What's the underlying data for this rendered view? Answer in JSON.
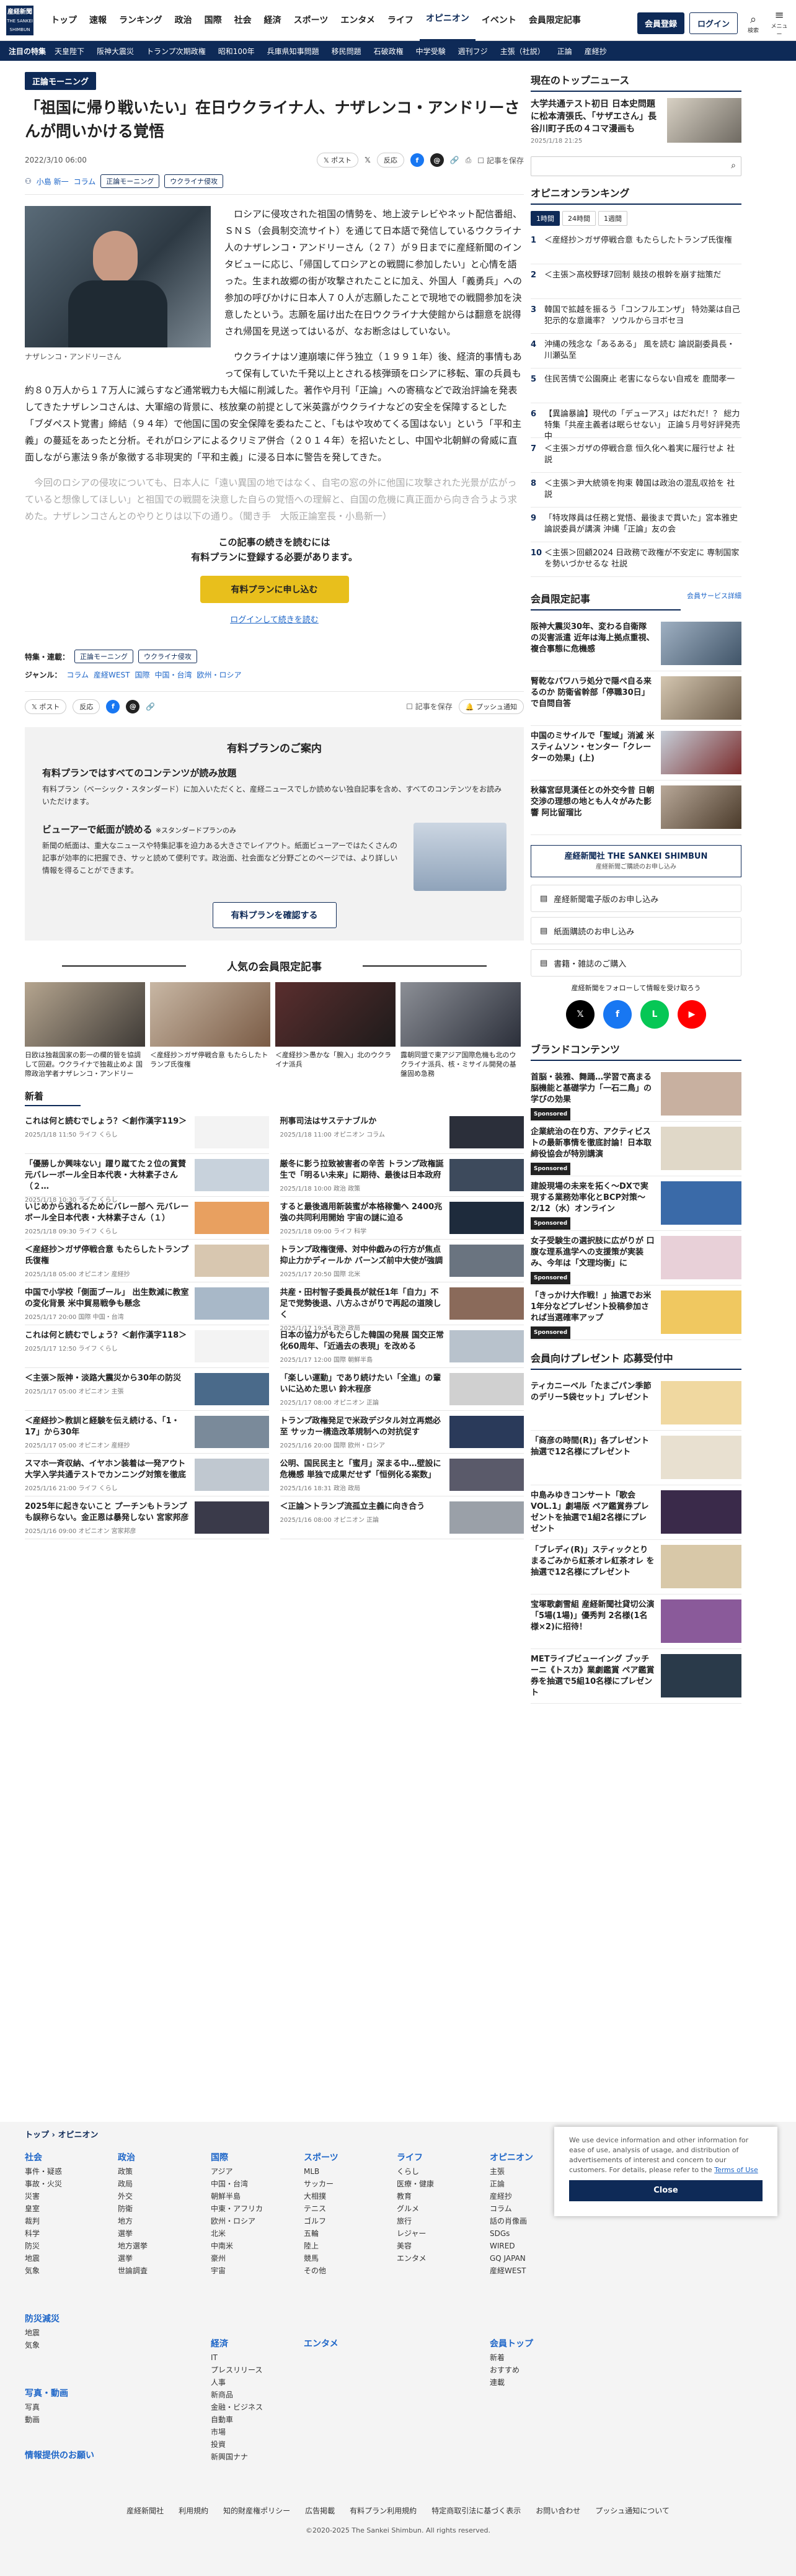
{
  "header": {
    "logo": "産経新聞",
    "logo_sub": "THE SANKEI SHIMBUN",
    "nav": [
      "トップ",
      "速報",
      "ランキング",
      "政治",
      "国際",
      "社会",
      "経済",
      "スポーツ",
      "エンタメ",
      "ライフ",
      "オピニオン",
      "イベント",
      "会員限定記事"
    ],
    "nav_active": "オピニオン",
    "register": "会員登録",
    "login": "ログイン",
    "search_label": "検索",
    "menu_label": "メニュー"
  },
  "subnav": [
    "注目の特集",
    "天皇陛下",
    "阪神大震災",
    "トランプ次期政権",
    "昭和100年",
    "兵庫県知事問題",
    "移民問題",
    "石破政権",
    "中学受験",
    "週刊フジ",
    "主張（社説）",
    "正論",
    "産経抄"
  ],
  "article": {
    "tag": "正論モーニング",
    "title": "「祖国に帰り戦いたい」在日ウクライナ人、ナザレンコ・アンドリーさんが問いかける覚悟",
    "date": "2022/3/10 06:00",
    "post_label": "ポスト",
    "fb_label": "反応",
    "save_label": "記事を保存",
    "author": "小島 新一",
    "author_section": "コラム",
    "tags": [
      "正論モーニング",
      "ウクライナ侵攻"
    ],
    "caption": "ナザレンコ・アンドリーさん",
    "para1": "ロシアに侵攻された祖国の情勢を、地上波テレビやネット配信番組、ＳＮＳ（会員制交流サイト）を通じて日本語で発信しているウクライナ人のナザレンコ・アンドリーさん（２７）が９日までに産経新聞のインタビューに応じ、「帰国してロシアとの戦闘に参加したい」と心情を語った。生まれ故郷の街が攻撃されたことに加え、外国人「義勇兵」への参加の呼びかけに日本人７０人が志願したことで現地での戦闘参加を決意したという。志願を届け出た在日ウクライナ大使館からは翻意を説得され帰国を見送ってはいるが、なお断念はしていない。",
    "para2": "ウクライナはソ連崩壊に伴う独立（１９９１年）後、経済的事情もあって保有していた千発以上とされる核弾頭をロシアに移転、軍の兵員も約８０万人から１７万人に減らすなど通常戦力も大幅に削減した。著作や月刊「正論」への寄稿などで政治評論を発表してきたナザレンコさんは、大軍縮の背景に、核放棄の前提として米英露がウクライナなどの安全を保障するとした「ブダペスト覚書」締結（９４年）で他国に国の安全保障を委ねたこと、「もはや攻めてくる国はない」という「平和主義」の蔓延をあったと分析。それがロシアによるクリミア併合（２０１４年）を招いたとし、中国や北朝鮮の脅威に直面しながら憲法９条が象徴する非現実的「平和主義」に浸る日本に警告を発してきた。",
    "para3": "今回のロシアの侵攻についても、日本人に「遠い異国の地ではなく、自宅の窓の外に他国に攻撃された光景が広がっていると想像してほしい」と祖国での戦闘を決意した自らの覚悟への理解と、自国の危機に真正面から向き合うよう求めた。ナザレンコさんとのやりとりは以下の通り。（聞き手　大阪正論室長・小島新一）",
    "wall_text1": "この記事の続きを読むには",
    "wall_text2": "有料プランに登録する必要があります。",
    "wall_cta": "有料プランに申し込む",
    "wall_login": "ログインして続きを読む",
    "feature_label": "特集・連載：",
    "features": [
      "正論モーニング",
      "ウクライナ侵攻"
    ],
    "genre_label": "ジャンル：",
    "genres": [
      "コラム",
      "産経WEST",
      "国際",
      "中国・台湾",
      "欧州・ロシア"
    ],
    "push_label": "プッシュ通知"
  },
  "plan": {
    "title": "有料プランのご案内",
    "h1": "有料プランではすべてのコンテンツが読み放題",
    "d1": "有料プラン（ベーシック・スタンダード）に加入いただくと、産経ニュースでしか読めない独自記事を含め、すべてのコンテンツをお読みいただけます。",
    "h2": "ビューアーで紙面が読める",
    "h2_note": "※スタンダードプランのみ",
    "d2": "新聞の紙面は、重大なニュースや特集記事を迫力ある大きさでレイアウト。紙面ビューアーではたくさんの記事が効率的に把握でき、サッと読めて便利です。政治面、社会面など分野ごとのページでは、より詳しい情報を得ることができます。",
    "button": "有料プランを確認する"
  },
  "popular": {
    "title": "人気の会員限定記事",
    "items": [
      "日欧は独裁国家の影一の欄的管を協調して回避。ウクライナで独裁止めよ 国際政治学者ナザレンコ・アンドリー",
      "＜産経抄＞ガザ停戦合意 もたらしたトランプ氏復権",
      "＜産経抄＞愚かな「腕入」北のウクライナ派兵",
      "露朝同盟で東アジア国際危機も北のウクライナ派兵、核・ミサイル開発の基盤固め急務"
    ]
  },
  "news": {
    "title": "新着",
    "items": [
      {
        "t": "これは何と読むでしょう？＜創作漢字119＞",
        "d": "2025/1/18 11:50",
        "c": "ライフ くらし"
      },
      {
        "t": "刑事司法はサステナブルか",
        "d": "2025/1/18 11:00",
        "c": "オピニオン コラム"
      },
      {
        "t": "「優勝しか興味ない」躍り蹴てた２位の賞賛 元バレーボール全日本代表・大林素子さん（２…",
        "d": "2025/1/18 10:30",
        "c": "ライフ くらし"
      },
      {
        "t": "厳冬に影う拉致被害者の辛苦 トランプ政権誕生で「明るい未来」に期待、最後は日本政府",
        "d": "2025/1/18 10:00",
        "c": "政治 政策"
      },
      {
        "t": "いじめから逃れるためにバレー部へ 元バレーボール全日本代表・大林素子さん（１）",
        "d": "2025/1/18 09:30",
        "c": "ライフ くらし"
      },
      {
        "t": "すると最後適用新装蜜が本格稼働へ 2400兆強の共同利用開始 宇宙の謎に迫る",
        "d": "2025/1/18 09:00",
        "c": "ライフ 科学"
      },
      {
        "t": "＜産経抄＞ガザ停戦合意 もたらしたトランプ氏復権",
        "d": "2025/1/18 05:00",
        "c": "オピニオン 産経抄"
      },
      {
        "t": "トランプ政権復帰、対中仲戯みの行方が焦点 抑止力かディールか バーンズ前中大使が強調",
        "d": "2025/1/17 20:50",
        "c": "国際 北米"
      },
      {
        "t": "中国で小学校「側面ブール」 出生数減に教室の変化背景 米中貿易戦争も懸念",
        "d": "2025/1/17 20:00",
        "c": "国際 中国・台湾"
      },
      {
        "t": "共産・田村智子委員長が就任1年「自力」不足で党勢後退、八方ふさがりで再起の道険しく",
        "d": "2025/1/17 19:54",
        "c": "政治 政局"
      },
      {
        "t": "これは何と読むでしょう？＜創作漢字118＞",
        "d": "2025/1/17 12:50",
        "c": "ライフ くらし"
      },
      {
        "t": "日本の協力がもたらした韓国の発展 国交正常化60周年、「近過去の表現」を改める",
        "d": "2025/1/17 12:00",
        "c": "国際 朝鮮半島"
      },
      {
        "t": "＜主張＞阪神・淡路大震災から30年の防災",
        "d": "2025/1/17 05:00",
        "c": "オピニオン 主張"
      },
      {
        "t": "「楽しい運動」であり続けたい「全進」の輩いに込めた思い 鈴木程彦",
        "d": "2025/1/17 08:00",
        "c": "オピニオン 正論"
      },
      {
        "t": "＜産経抄＞教訓と経験を伝え続ける、「1・17」から30年",
        "d": "2025/1/17 05:00",
        "c": "オピニオン 産経抄"
      },
      {
        "t": "トランプ政権発足で米政デジタル対立再燃必至 サッカー構造改革規制への対抗促す",
        "d": "2025/1/16 20:00",
        "c": "国際 欧州・ロシア"
      },
      {
        "t": "スマホ一斉収納、イヤホン装着は一発アウト 大学入学共通テストでカンニング対策を徹底",
        "d": "2025/1/16 21:00",
        "c": "ライフ くらし"
      },
      {
        "t": "公明、国民民主と「蜜月」深まる中…壁設に危機感 単独で成果だせず「恒例化る案数」",
        "d": "2025/1/16 18:31",
        "c": "政治 政局"
      },
      {
        "t": "2025年に起きないこと プーチンもトランプも誤称らない。金正恩は暴発しない 宮家邦彦",
        "d": "2025/1/16 09:00",
        "c": "オピニオン 宮家邦彦"
      },
      {
        "t": "＜正論＞トランプ流孤立主義に向き合う",
        "d": "2025/1/16 08:00",
        "c": "オピニオン 正論"
      }
    ]
  },
  "side": {
    "top_title": "現在のトップニュース",
    "top": {
      "t": "大学共通テスト初日 日本史問題に松本清張氏、「サザエさん」長谷川町子氏の４コマ漫画も",
      "d": "2025/1/18 21:25"
    },
    "search_placeholder": "",
    "rank_title": "オピニオンランキング",
    "rank_tabs": [
      "1時間",
      "24時間",
      "1週間"
    ],
    "rank": [
      "＜産経抄＞ガザ停戦合意 もたらしたトランプ氏復権",
      "＜主張＞高校野球7回制 競技の根幹を崩す拙策だ",
      "韓国で拡越を振るう「コンフルエンザ」 特効薬は自己犯示的な意識率？ ソウルからヨボセヨ",
      "沖縄の残念な「あるある」 風を読む 論説副委員長・川瀬弘至",
      "住民苦情で公園廃止 老害にならない自戒を 鹿間孝一",
      "【異論暴論】現代の「デューアス」はだれだ！？ 総力特集「共産主義者は眠らせない」 正論５月号好評発売中",
      "＜主張＞ガザの停戦合意 恒久化へ着実に履行せよ 社説",
      "＜主張＞尹大統領を拘束 韓国は政治の混乱収拾を 社説",
      "「特攻隊員は任務と覚悟、最後まで貫いた」宮本雅史論説委員が講演 沖縄「正論」友の会",
      "＜主張＞回顧2024 日政務で政権が不安定に 専制国家を勢いづかせるな 社説"
    ],
    "member_title": "会員限定記事",
    "member_more": "会員サービス詳細",
    "member": [
      "阪神大震災30年、変わる自衛隊の災害派遣 近年は海上拠点重視、複合事態に危機感",
      "腎乾なパワハラ処分で隠ぺ自る来るのか 防衛省幹部「停職30日」で自問自答",
      "中国のミサイルで「聖域」消滅 米スティムソン・センター「クレーターの効果」(上)",
      "秋篠宮邸見漢任との外交今昔 日朝交渉の理想の地とも人々がみた影響 阿比留瑠比"
    ],
    "banner": "産経新聞社 THE SANKEI SHIMBUN",
    "banner_sub": "産経新聞ご購読のお申し込み",
    "services": [
      "産経新聞電子版のお申し込み",
      "紙面購読のお申し込み",
      "書籍・雑誌のご購入"
    ],
    "follow": "産経新聞をフォローして情報を受け取ろう",
    "brand_title": "ブランドコンテンツ",
    "brand": [
      "首脳・装雅、舞踊…学習で高まる脳機能と基礎学力「一石二鳥」の学びの効果",
      "企業統治の在り方、アクティビストの最新事情を徹底討論！日本取締役協会が特別講演",
      "建設現場の未来を拓く〜DXで実現する業務効率化とBCP対策〜 2/12（水）オンライン",
      "女子受験生の選択肢に広がりが 口腹な理系進学への支援策が実装み、今年は「文理均衡」に",
      "「きっかけ大作戦！」抽選でお米1年分などプレゼント投稿参加されば当選確率アップ"
    ],
    "sponsored": "Sponsored",
    "present_title": "会員向けプレゼント 応募受付中",
    "present": [
      "ティカニーベル「たまごパン季節のデリー5袋セット」プレゼント",
      "「商彦の時間(R)」各プレゼント 抽選で12名様にプレゼント",
      "中島みゆきコンサート「歌会VOL.1」劇場版 ペア鑑賞券プレゼントを抽選で1組2名様にプレゼント",
      "「ブレディ(R)」スティックとりまるごみから紅茶オレ紅茶オレ を抽選で12名様にプレゼント",
      "宝塚歌劇雪組 産経新聞社貸切公演「5場(1場)」優秀判 2名様(1名様×2)に招待！",
      "METライブビューイング ブッチーニ《トスカ》業劇鑑賞 ペア鑑賞券を抽選で5組10名様にプレゼント"
    ]
  },
  "footer": {
    "crumb": [
      "トップ",
      "オピニオン"
    ],
    "cols": [
      {
        "title": "社会",
        "items": [
          "事件・疑惑",
          "事故・火災",
          "災害",
          "皇室",
          "裁判",
          "科学",
          "防災",
          "地震",
          "気象"
        ]
      },
      {
        "title": "政治",
        "items": [
          "政策",
          "政局",
          "外交",
          "防衛",
          "地方",
          "選挙",
          "地方選挙",
          "選挙",
          "世論調査"
        ]
      },
      {
        "title": "国際",
        "items": [
          "アジア",
          "中国・台湾",
          "朝鮮半島",
          "中東・アフリカ",
          "欧州・ロシア",
          "北米",
          "中南米",
          "豪州",
          "宇宙"
        ]
      },
      {
        "title": "スポーツ",
        "items": [
          "MLB",
          "サッカー",
          "大相撲",
          "テニス",
          "ゴルフ",
          "五輪",
          "陸上",
          "競馬",
          "その他"
        ]
      },
      {
        "title": "ライフ",
        "items": [
          "くらし",
          "医療・健康",
          "教育",
          "グルメ",
          "旅行",
          "レジャー",
          "美容",
          "エンタメ"
        ]
      },
      {
        "title": "オピニオン",
        "items": [
          "主張",
          "正論",
          "産経抄",
          "コラム",
          "話の肖像画",
          "SDGs",
          "WIRED",
          "GQ JAPAN",
          "産経WEST"
        ]
      }
    ],
    "extra": [
      {
        "title": "防災減災",
        "items": [
          "地震",
          "気象"
        ]
      },
      {
        "title": "写真・動画",
        "items": [
          "写真",
          "動画"
        ]
      },
      {
        "title": "情報提供のお願い",
        "items": []
      },
      {
        "title": "経済",
        "items": [
          "IT",
          "プレスリリース",
          "人事",
          "新商品",
          "金融・ビジネス",
          "自動車",
          "市場",
          "投資",
          "新興国ナナ"
        ]
      },
      {
        "title": "エンタメ",
        "items": []
      },
      {
        "title": "会員トップ",
        "items": [
          "新着",
          "おすすめ",
          "連載"
        ]
      }
    ],
    "bottom": [
      "産経新聞社",
      "利用規約",
      "知的財産権ポリシー",
      "広告掲載",
      "有料プラン利用規約",
      "特定商取引法に基づく表示",
      "お問い合わせ",
      "プッシュ通知について"
    ],
    "copyright": "©2020-2025 The Sankei Shimbun. All rights reserved."
  },
  "cookie": {
    "text": "We use device information and other information for ease of use, analysis of usage, and distribution of advertisements of interest and concern to our customers. For details, please refer to the",
    "link": "Terms of Use",
    "button": "Close"
  }
}
